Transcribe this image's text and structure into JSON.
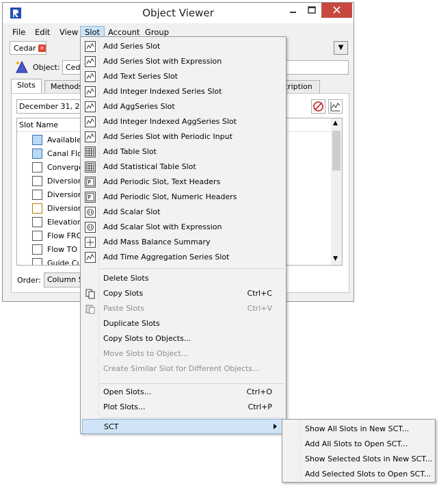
{
  "window": {
    "title": "Object Viewer",
    "accent": "#c7483f"
  },
  "menubar": [
    "File",
    "Edit",
    "View",
    "Slot",
    "Account",
    "Group"
  ],
  "object_tab": {
    "label": "Cedar",
    "close_icon": "close-x-icon"
  },
  "object": {
    "label": "Object:",
    "value": "Cedar"
  },
  "tabs": [
    "Slots",
    "Methods",
    "cription"
  ],
  "panel": {
    "date": "December 31, 201"
  },
  "list": {
    "header": "Slot Name",
    "rows": [
      "Available",
      "Canal Flow",
      "Converge",
      "Diversion",
      "Diversion",
      "Diversion",
      "Elevation",
      "Flow FROM",
      "Flow TO P",
      "Guide Cur"
    ]
  },
  "order": {
    "label": "Order:",
    "value": "Column Sor"
  },
  "slot_menu": {
    "items": [
      {
        "label": "Add Series Slot",
        "icon": "series-slot-icon"
      },
      {
        "label": "Add Series Slot with Expression",
        "icon": "series-expression-icon"
      },
      {
        "label": "Add Text Series Slot",
        "icon": "text-series-icon"
      },
      {
        "label": "Add Integer Indexed Series Slot",
        "icon": "integer-series-icon"
      },
      {
        "label": "Add AggSeries Slot",
        "icon": "aggseries-icon"
      },
      {
        "label": "Add Integer Indexed AggSeries Slot",
        "icon": "integer-aggseries-icon"
      },
      {
        "label": "Add Series Slot with Periodic Input",
        "icon": "periodic-input-icon"
      },
      {
        "label": "Add Table Slot",
        "icon": "table-slot-icon"
      },
      {
        "label": "Add Statistical Table Slot",
        "icon": "stat-table-icon"
      },
      {
        "label": "Add Periodic Slot, Text Headers",
        "icon": "periodic-text-icon"
      },
      {
        "label": "Add Periodic Slot, Numeric Headers",
        "icon": "periodic-numeric-icon"
      },
      {
        "label": "Add Scalar Slot",
        "icon": "scalar-slot-icon"
      },
      {
        "label": "Add Scalar Slot with Expression",
        "icon": "scalar-expression-icon"
      },
      {
        "label": "Add Mass Balance Summary",
        "icon": "mass-balance-icon"
      },
      {
        "label": "Add Time Aggregation Series Slot",
        "icon": "time-aggregation-icon"
      }
    ],
    "edit_items": [
      {
        "label": "Delete Slots",
        "shortcut": ""
      },
      {
        "label": "Copy Slots",
        "shortcut": "Ctrl+C"
      },
      {
        "label": "Paste Slots",
        "shortcut": "Ctrl+V"
      },
      {
        "label": "Duplicate Slots",
        "shortcut": ""
      },
      {
        "label": "Copy Slots to Objects...",
        "shortcut": ""
      },
      {
        "label": "Move Slots to Object...",
        "shortcut": ""
      },
      {
        "label": "Create Similar Slot for Different Objects...",
        "shortcut": ""
      }
    ],
    "open_items": [
      {
        "label": "Open Slots...",
        "shortcut": "Ctrl+O"
      },
      {
        "label": "Plot Slots...",
        "shortcut": "Ctrl+P"
      }
    ],
    "sct": "SCT"
  },
  "sct_menu": [
    "Show All Slots in New SCT...",
    "Add All Slots to Open SCT...",
    "Show Selected Slots in New SCT...",
    "Add Selected Slots to Open SCT..."
  ]
}
